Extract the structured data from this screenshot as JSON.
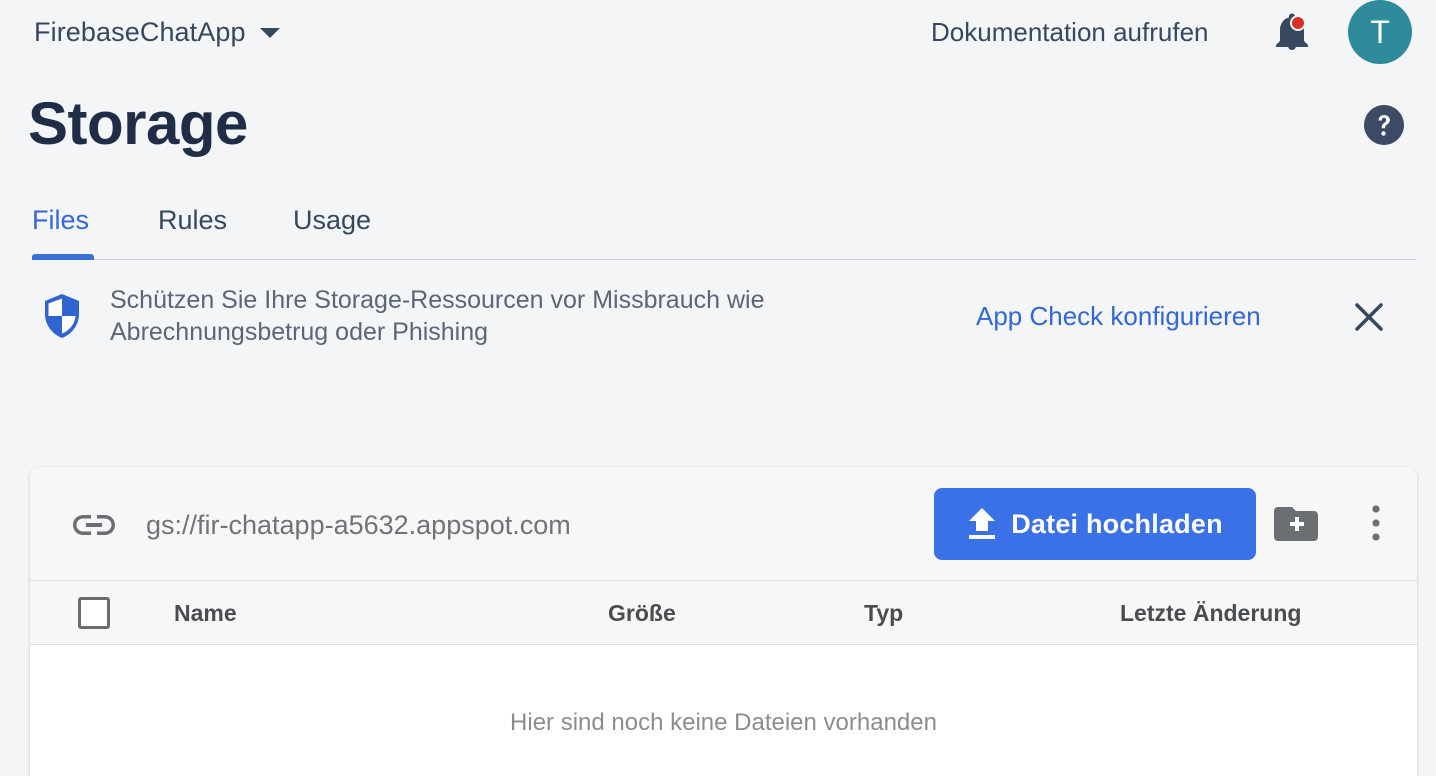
{
  "topbar": {
    "project_name": "FirebaseChatApp",
    "docs_link": "Dokumentation aufrufen",
    "avatar_initial": "T",
    "avatar_color": "#2e8b9b",
    "notification_dot_color": "#d93025"
  },
  "page": {
    "title": "Storage"
  },
  "tabs": [
    {
      "label": "Files",
      "active": true
    },
    {
      "label": "Rules",
      "active": false
    },
    {
      "label": "Usage",
      "active": false
    }
  ],
  "banner": {
    "message": "Schützen Sie Ihre Storage-Ressourcen vor Missbrauch wie Abrechnungsbetrug oder Phishing",
    "action": "App Check konfigurieren"
  },
  "storage": {
    "bucket": "gs://fir-chatapp-a5632.appspot.com",
    "upload_label": "Datei hochladen",
    "columns": [
      "Name",
      "Größe",
      "Typ",
      "Letzte Änderung"
    ],
    "empty_message": "Hier sind noch keine Dateien vorhanden"
  },
  "colors": {
    "accent": "#3367d6",
    "button": "#3a71e6",
    "background": "#f4f5f7"
  }
}
